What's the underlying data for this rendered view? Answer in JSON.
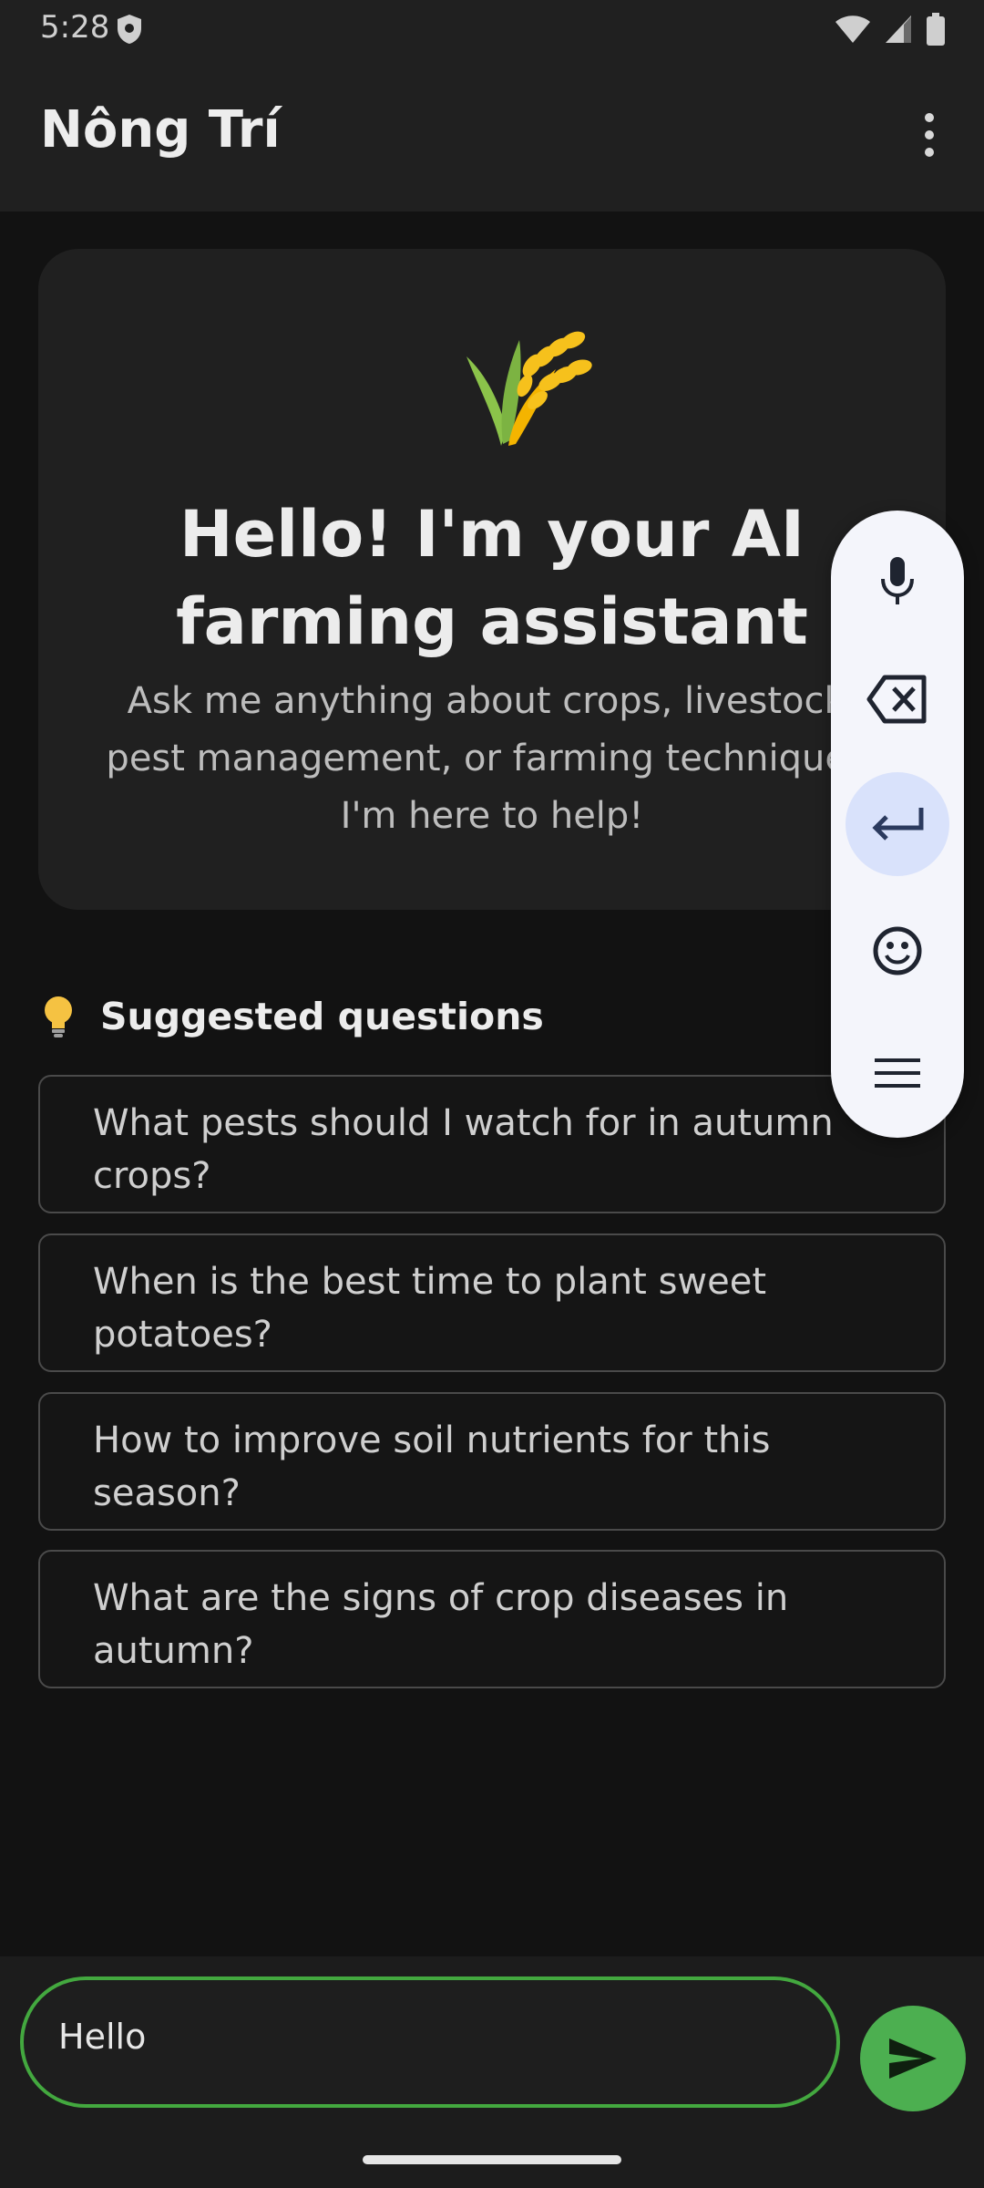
{
  "status_bar": {
    "time": "5:28",
    "icons": [
      "shield-icon",
      "wifi-icon",
      "signal-icon",
      "battery-icon"
    ]
  },
  "app_bar": {
    "title": "Nông Trí",
    "menu_icon": "more-vert-icon"
  },
  "welcome": {
    "icon": "wheat-icon",
    "title": "Hello! I'm your AI farming assistant",
    "subtitle": "Ask me anything about crops, livestock, pest management, or farming techniques. I'm here to help!"
  },
  "suggestions": {
    "icon": "lightbulb-icon",
    "title": "Suggested questions",
    "items": [
      "What pests should I watch for in autumn crops?",
      "When is the best time to plant sweet potatoes?",
      "How to improve soil nutrients for this season?",
      "What are the signs of crop diseases in autumn?"
    ]
  },
  "input": {
    "value": "Hello",
    "send_icon": "send-icon"
  },
  "keyboard_toolbar": {
    "buttons": [
      "microphone-icon",
      "backspace-icon",
      "enter-icon",
      "emoji-icon",
      "menu-icon"
    ],
    "active": "enter-icon"
  },
  "colors": {
    "accent_green": "#4caf50",
    "card_bg": "#202020",
    "background": "#121212",
    "toolbar_bg": "#f4f5fb",
    "toolbar_active": "#d9e2fb"
  }
}
